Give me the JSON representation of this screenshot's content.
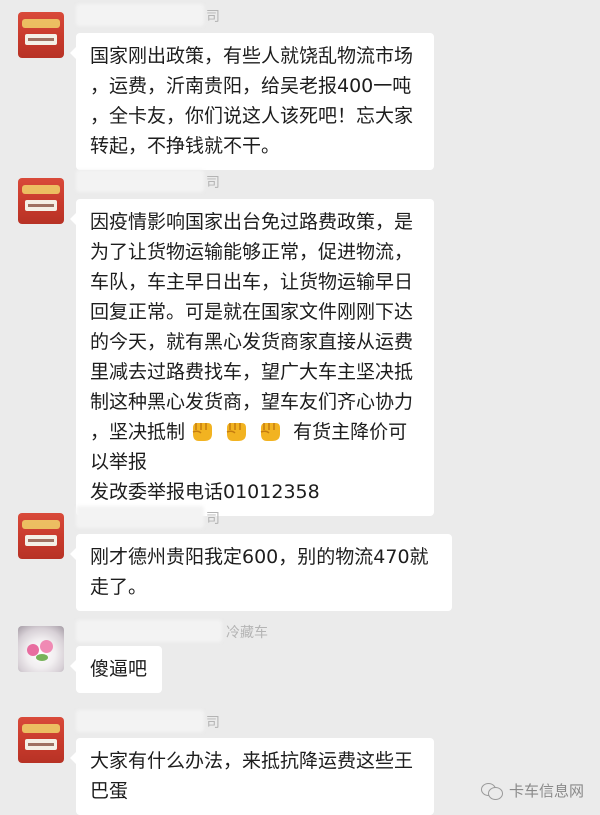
{
  "messages": [
    {
      "name_suffix": "司",
      "avatar": "red-banner-avatar",
      "text": "国家刚出政策，有些人就饶乱物流市场\n，运费，沂南贵阳，给吴老报400一吨\n，全卡友，你们说这人该死吧！忘大家\n转起，不挣钱就不干。"
    },
    {
      "name_suffix": "司",
      "avatar": "red-banner-avatar",
      "text_before": "因疫情影响国家出台免过路费政策，是\n为了让货物运输能够正常，促进物流，\n车队，车主早日出车，让货物运输早日\n回复正常。可是就在国家文件刚刚下达\n的今天，就有黑心发货商家直接从运费\n里减去过路费找车，望广大车主坚决抵\n制这种黑心发货商，望车友们齐心协力\n，坚决抵制",
      "text_after": "有货主降价可\n以举报\n发改委举报电话01012358"
    },
    {
      "name_suffix": "司",
      "avatar": "red-banner-avatar",
      "text": "刚才德州贵阳我定600，别的物流470就\n走了。"
    },
    {
      "name_suffix": "冷藏车",
      "avatar": "cake-avatar",
      "text": "傻逼吧"
    },
    {
      "name_suffix": "司",
      "avatar": "red-banner-avatar",
      "text": "大家有什么办法，来抵抗降运费这些王\n巴蛋"
    }
  ],
  "watermark": {
    "icon": "wechat-icon",
    "text": "卡车信息网"
  }
}
